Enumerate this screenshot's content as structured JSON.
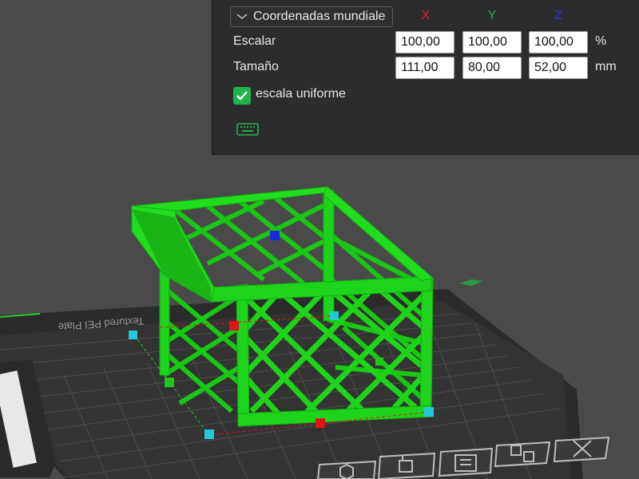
{
  "panel": {
    "coordinate_system": "Coordenadas mundiale",
    "axes": [
      {
        "label": "X",
        "color": "#e0202a"
      },
      {
        "label": "Y",
        "color": "#1fb34a"
      },
      {
        "label": "Z",
        "color": "#2a3bd8"
      }
    ],
    "rows": [
      {
        "label": "Escalar",
        "values": [
          "100,00",
          "100,00",
          "100,00"
        ],
        "unit": "%"
      },
      {
        "label": "Tamaño",
        "values": [
          "111,00",
          "80,00",
          "52,00"
        ],
        "unit": "mm"
      }
    ],
    "uniform_scale": {
      "label": "escala uniforme",
      "checked": true
    }
  },
  "viewport": {
    "bed_text": "Textured PEI Plate",
    "model_color": "#1ed41a",
    "gizmo_colors": {
      "x": "#e0121a",
      "y": "#1fc81a",
      "z": "#1a2ad8",
      "corner": "#20c8d8"
    }
  },
  "toolbar": {
    "buttons": [
      {
        "icon": "orient-icon"
      },
      {
        "icon": "arrange-icon"
      },
      {
        "icon": "layout-icon"
      },
      {
        "icon": "split-icon"
      },
      {
        "icon": "close-icon"
      }
    ]
  }
}
